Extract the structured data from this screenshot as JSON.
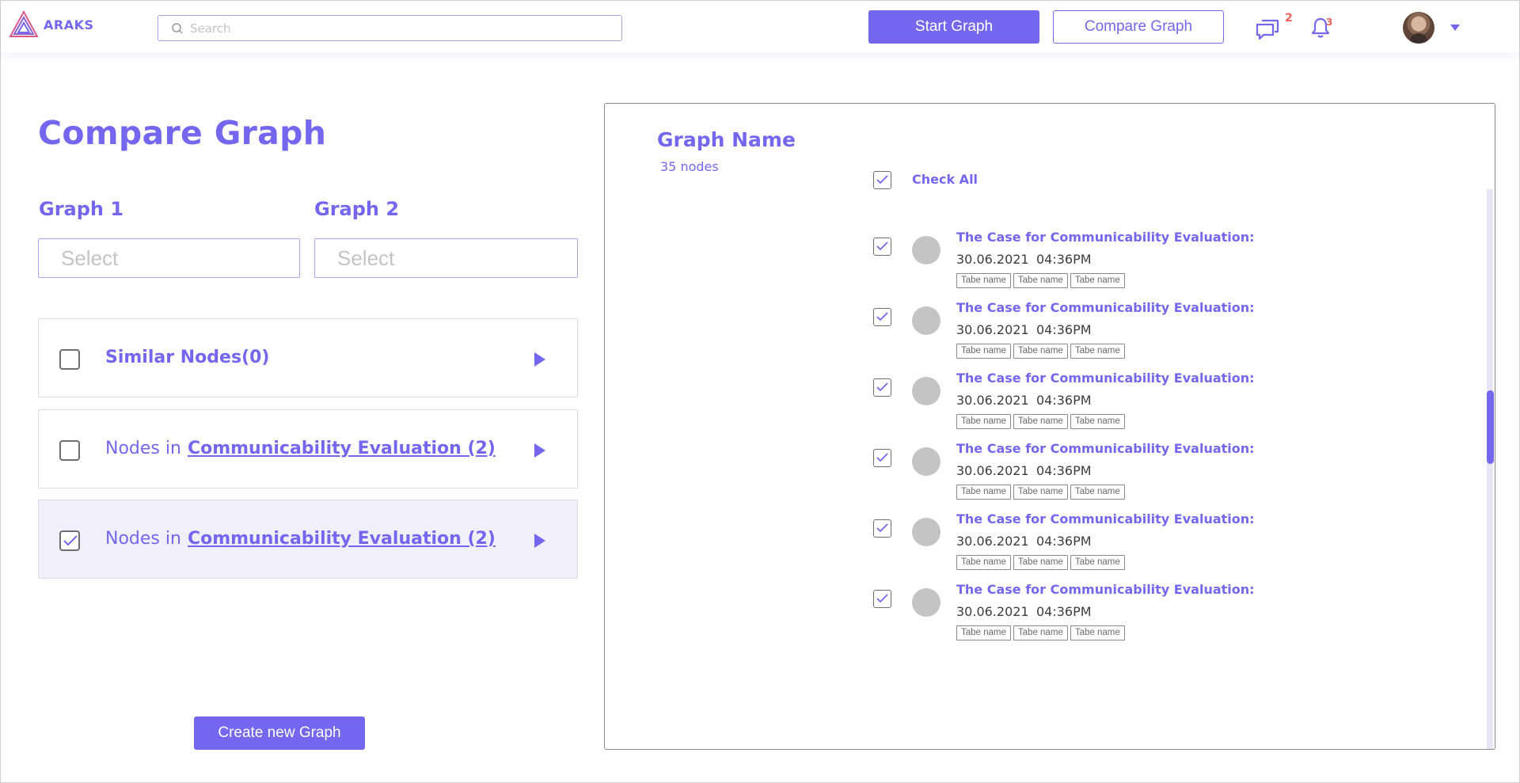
{
  "app": {
    "name": "ARAKS"
  },
  "header": {
    "search_placeholder": "Search",
    "start_graph_label": "Start Graph",
    "compare_graph_label": "Compare Graph",
    "messages_count": "2",
    "notifications_count": "3"
  },
  "left": {
    "title": "Compare Graph",
    "graph1_label": "Graph 1",
    "graph2_label": "Graph 2",
    "graph1_select": "Select",
    "graph2_select": "Select",
    "rows": [
      {
        "text": "Similar Nodes(0)",
        "checked": false
      },
      {
        "prefix": "Nodes in",
        "link": "Communicability Evaluation (2)",
        "checked": false
      },
      {
        "prefix": "Nodes in",
        "link": "Communicability Evaluation (2)",
        "checked": true
      }
    ],
    "create_button_label": "Create new Graph"
  },
  "right": {
    "graph_name": "Graph Name",
    "node_count": "35 nodes",
    "check_all_label": "Check All",
    "items": [
      {
        "title": "The Case for  Communicability Evaluation:",
        "date": "30.06.2021",
        "time": "04:36PM",
        "tags": [
          "Tabe name",
          "Tabe name",
          "Tabe name"
        ]
      },
      {
        "title": "The Case for  Communicability Evaluation:",
        "date": "30.06.2021",
        "time": "04:36PM",
        "tags": [
          "Tabe name",
          "Tabe name",
          "Tabe name"
        ]
      },
      {
        "title": "The Case for  Communicability Evaluation:",
        "date": "30.06.2021",
        "time": "04:36PM",
        "tags": [
          "Tabe name",
          "Tabe name",
          "Tabe name"
        ]
      },
      {
        "title": "The Case for  Communicability Evaluation:",
        "date": "30.06.2021",
        "time": "04:36PM",
        "tags": [
          "Tabe name",
          "Tabe name",
          "Tabe name"
        ]
      },
      {
        "title": "The Case for  Communicability Evaluation:",
        "date": "30.06.2021",
        "time": "04:36PM",
        "tags": [
          "Tabe name",
          "Tabe name",
          "Tabe name"
        ]
      },
      {
        "title": "The Case for  Communicability Evaluation:",
        "date": "30.06.2021",
        "time": "04:36PM",
        "tags": [
          "Tabe name",
          "Tabe name",
          "Tabe name"
        ]
      }
    ]
  },
  "colors": {
    "accent": "#7467ef",
    "badge": "#e8625a",
    "selected_row": "#f1effb"
  },
  "icons": [
    "araks-logo-icon",
    "search-icon",
    "chat-icon",
    "bell-icon",
    "avatar",
    "caret-down-icon",
    "checkbox-check-icon",
    "play-arrow-icon"
  ]
}
